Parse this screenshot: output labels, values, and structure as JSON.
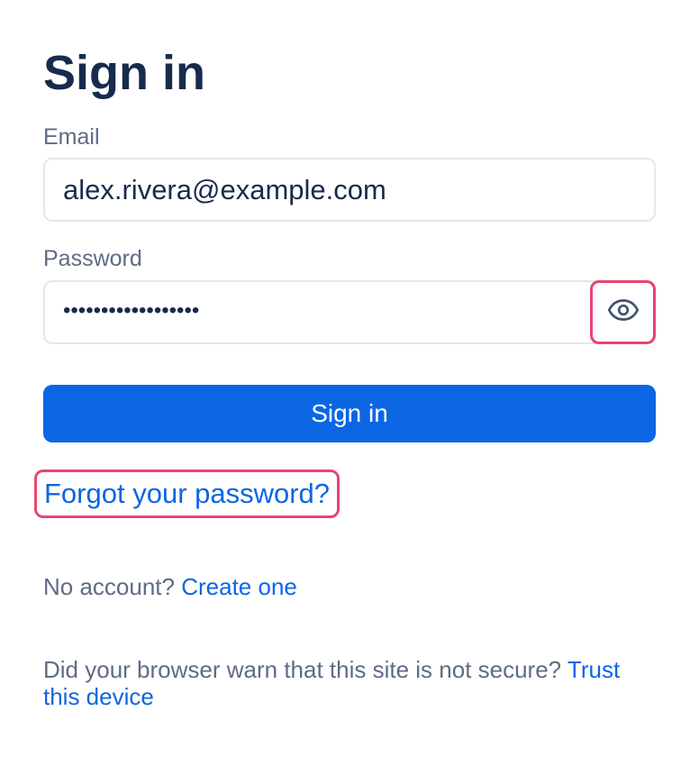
{
  "page": {
    "title": "Sign in"
  },
  "form": {
    "email": {
      "label": "Email",
      "value": "alex.rivera@example.com"
    },
    "password": {
      "label": "Password",
      "masked_value": "••••••••••••••••••",
      "toggle_icon": "eye-icon"
    },
    "submit_label": "Sign in",
    "forgot_label": "Forgot your password?"
  },
  "footer": {
    "no_account_text": "No account?",
    "create_label": "Create one",
    "warn_text": "Did your browser warn that this site is not secure?",
    "trust_label": "Trust this device"
  },
  "colors": {
    "primary": "#0c66e4",
    "heading": "#172b4d",
    "muted": "#5e6c84",
    "highlight": "#e8456f"
  }
}
